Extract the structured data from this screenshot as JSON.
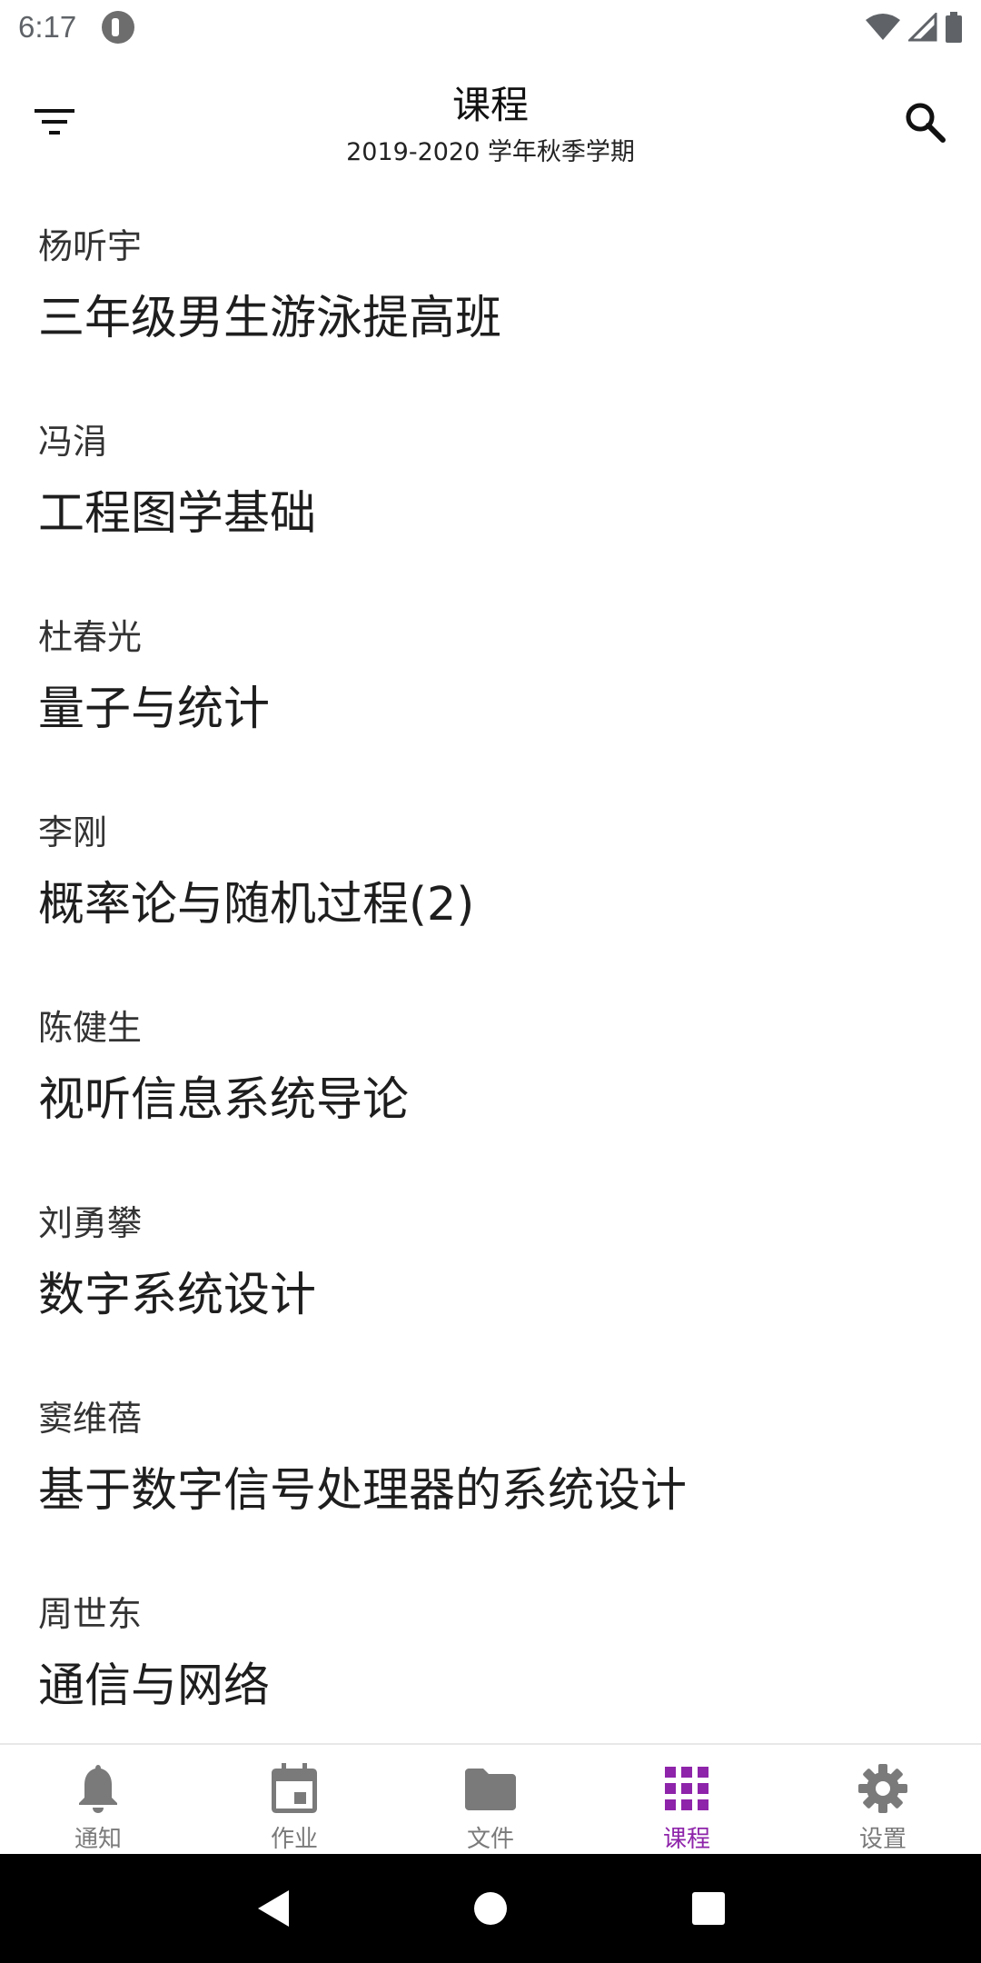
{
  "status": {
    "time": "6:17"
  },
  "header": {
    "title": "课程",
    "subtitle": "2019-2020 学年秋季学期",
    "menu_icon": "filter-icon",
    "search_icon": "search-icon"
  },
  "courses": [
    {
      "teacher": "杨听宇",
      "name": "三年级男生游泳提高班"
    },
    {
      "teacher": "冯涓",
      "name": "工程图学基础"
    },
    {
      "teacher": "杜春光",
      "name": "量子与统计"
    },
    {
      "teacher": "李刚",
      "name": "概率论与随机过程(2)"
    },
    {
      "teacher": "陈健生",
      "name": "视听信息系统导论"
    },
    {
      "teacher": "刘勇攀",
      "name": "数字系统设计"
    },
    {
      "teacher": "窦维蓓",
      "name": "基于数字信号处理器的系统设计"
    },
    {
      "teacher": "周世东",
      "name": "通信与网络"
    }
  ],
  "bottom_nav": {
    "items": [
      {
        "label": "通知",
        "icon": "bell-icon"
      },
      {
        "label": "作业",
        "icon": "calendar-icon"
      },
      {
        "label": "文件",
        "icon": "folder-icon"
      },
      {
        "label": "课程",
        "icon": "grid-icon"
      },
      {
        "label": "设置",
        "icon": "gear-icon"
      }
    ],
    "active_index": 3,
    "active_color": "#8e24aa",
    "inactive_color": "#7a7a7a"
  }
}
